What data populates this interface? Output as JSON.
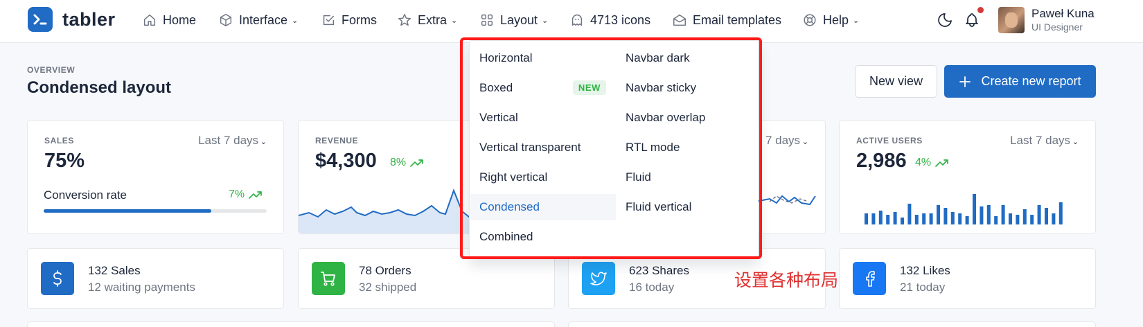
{
  "brand": {
    "name": "tabler"
  },
  "nav": {
    "home": "Home",
    "interface": "Interface",
    "forms": "Forms",
    "extra": "Extra",
    "layout": "Layout",
    "icons": "4713 icons",
    "email": "Email templates",
    "help": "Help"
  },
  "user": {
    "name": "Paweł Kuna",
    "role": "UI Designer"
  },
  "header": {
    "pretitle": "OVERVIEW",
    "title": "Condensed layout",
    "new_view": "New view",
    "create_report": "Create new report"
  },
  "cards": {
    "sales": {
      "label": "SALES",
      "period": "Last 7 days",
      "value": "75%",
      "conversion_label": "Conversion rate",
      "conversion_trend": "7%",
      "progress": 0.75
    },
    "revenue": {
      "label": "REVENUE",
      "value": "$4,300",
      "trend": "8%"
    },
    "third": {
      "period_partial": "7 days"
    },
    "active_users": {
      "label": "ACTIVE USERS",
      "period": "Last 7 days",
      "value": "2,986",
      "trend": "4%"
    }
  },
  "stats": [
    {
      "main": "132 Sales",
      "sub": "12 waiting payments",
      "color": "#206bc4",
      "icon": "dollar-icon"
    },
    {
      "main": "78 Orders",
      "sub": "32 shipped",
      "color": "#2fb344",
      "icon": "cart-icon"
    },
    {
      "main": "623 Shares",
      "sub": "16 today",
      "color": "#1da1f2",
      "icon": "twitter-icon"
    },
    {
      "main": "132 Likes",
      "sub": "21 today",
      "color": "#1877f2",
      "icon": "facebook-icon"
    }
  ],
  "layout_menu": {
    "left": [
      "Horizontal",
      "Boxed",
      "Vertical",
      "Vertical transparent",
      "Right vertical",
      "Condensed",
      "Combined"
    ],
    "right": [
      "Navbar dark",
      "Navbar sticky",
      "Navbar overlap",
      "RTL mode",
      "Fluid",
      "Fluid vertical"
    ],
    "badge": "NEW",
    "active": "Condensed"
  },
  "annotation": "设置各种布局",
  "colors": {
    "primary": "#206bc4",
    "success": "#2fb344",
    "highlight": "#ff1a1a"
  }
}
